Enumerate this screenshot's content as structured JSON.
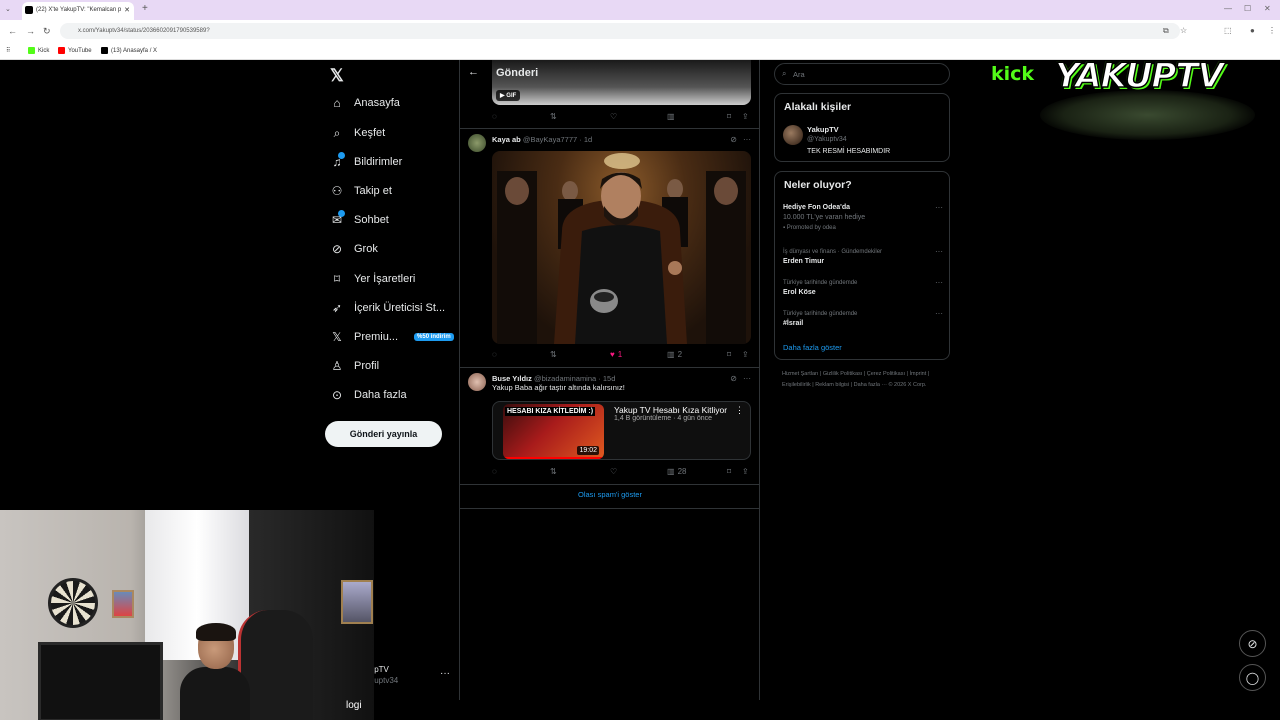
{
  "browser": {
    "tab_title": "(22) X'te YakupTV: \"Kemalcan p",
    "url": "x.com/Yakuptv34/status/2036602091790539589?",
    "bookmarks": [
      {
        "label": "Kick",
        "color": "#53fc18"
      },
      {
        "label": "YouTube",
        "color": "#ff0000"
      },
      {
        "label": "(13) Anasayfa / X",
        "color": "#000000"
      }
    ]
  },
  "nav": {
    "items": [
      {
        "label": "Anasayfa",
        "icon": "home-icon"
      },
      {
        "label": "Keşfet",
        "icon": "search-icon"
      },
      {
        "label": "Bildirimler",
        "icon": "bell-icon"
      },
      {
        "label": "Takip et",
        "icon": "follow-icon"
      },
      {
        "label": "Sohbet",
        "icon": "chat-icon"
      },
      {
        "label": "Grok",
        "icon": "grok-icon"
      },
      {
        "label": "Yer İşaretleri",
        "icon": "bookmark-icon"
      },
      {
        "label": "İçerik Üreticisi St...",
        "icon": "rocket-icon"
      },
      {
        "label": "Premiu...",
        "icon": "x-icon"
      },
      {
        "label": "Profil",
        "icon": "person-icon"
      },
      {
        "label": "Daha fazla",
        "icon": "more-icon"
      }
    ],
    "premium_badge": "%50 indirim",
    "post_button": "Gönderi yayınla",
    "account_name": "ıpTV",
    "account_handle": "ıuptv34"
  },
  "feed": {
    "title": "Gönderi",
    "gif_badge": "GIF",
    "tweets": [
      {
        "name": "Kaya ab",
        "handle": "@BayKaya7777",
        "time": "1d",
        "likes": "1",
        "views": "2"
      },
      {
        "name": "Buse Yıldız",
        "handle": "@bizadaminamina",
        "time": "15d",
        "text": "Yakup Baba ağır taştır altında kalırsınız!",
        "views": "28",
        "video": {
          "thumb_text": "HESABI KIZA KİTLEDİM :)",
          "duration": "19:02",
          "title": "Yakup TV Hesabı Kıza Kitliyor",
          "meta": "1,4 B görüntüleme · 4 gün önce"
        }
      }
    ],
    "spam_link": "Olası spam'i göster"
  },
  "sidebar": {
    "search_placeholder": "Ara",
    "related_title": "Alakalı kişiler",
    "related": {
      "name": "YakupTV",
      "handle": "@Yakuptv34",
      "bio": "TEK RESMİ HESABIMDIR"
    },
    "trends_title": "Neler oluyor?",
    "trends": [
      {
        "context": "",
        "title": "Hediye Fon Odea'da",
        "sub": "10.000 TL'ye varan hediye",
        "promo": "Promoted by odea"
      },
      {
        "context": "İş dünyası ve finans · Gündemdekiler",
        "title": "Erden Timur",
        "sub": "",
        "promo": ""
      },
      {
        "context": "Türkiye tarihinde gündemde",
        "title": "Erol Köse",
        "sub": "",
        "promo": ""
      },
      {
        "context": "Türkiye tarihinde gündemde",
        "title": "#İsrail",
        "sub": "",
        "promo": ""
      }
    ],
    "show_more": "Daha fazla göster",
    "footer": "Hizmet Şartları | Gizlilik Politikası | Çerez Politikası | İmprint | Erişilebilirlik | Reklam bilgisi | Daha fazla ··· © 2026 X Corp."
  },
  "overlay": {
    "kick": "kick",
    "brand": "YAKUPTV",
    "webcam_label": "logi"
  },
  "colors": {
    "accent": "#1d9bf0",
    "like": "#f91880",
    "kick_green": "#53fc18"
  }
}
